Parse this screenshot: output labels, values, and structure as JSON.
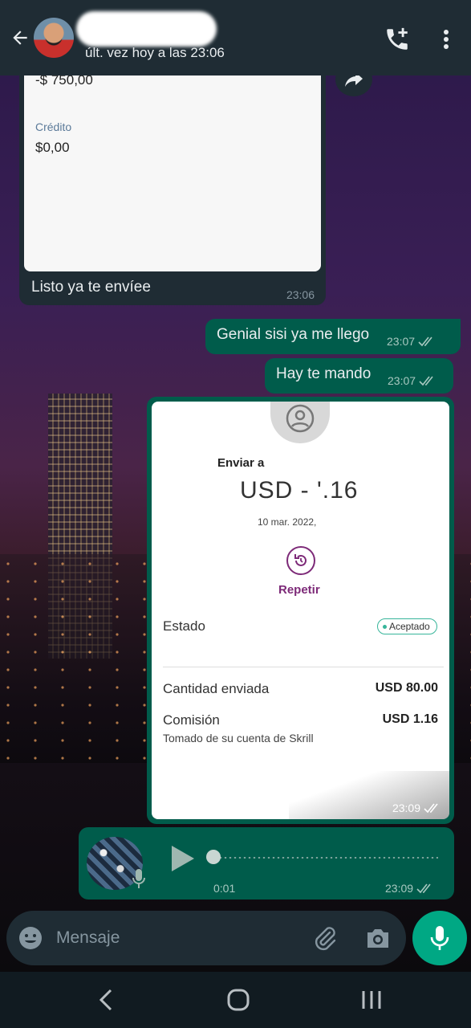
{
  "header": {
    "status": "últ. vez hoy a las 23:06"
  },
  "messages": {
    "incoming": {
      "card_amount": "-$ 750,00",
      "card_credit_label": "Crédito",
      "card_credit_value": "$0,00",
      "text": "Listo ya te envíee",
      "time": "23:06"
    },
    "out1": {
      "text": "Genial sisi ya me llego",
      "time": "23:07"
    },
    "out2": {
      "text": "Hay te mando",
      "time": "23:07"
    },
    "receipt": {
      "send_to": "Enviar a",
      "amount": "USD -    '.16",
      "date": "10 mar. 2022,",
      "repeat": "Repetir",
      "status_label": "Estado",
      "status_value": "Aceptado",
      "sent_label": "Cantidad enviada",
      "sent_value": "USD 80.00",
      "fee_label": "Comisión",
      "fee_value": "USD 1.16",
      "fee_note": "Tomado de su cuenta de Skrill",
      "time": "23:09"
    },
    "audio": {
      "duration": "0:01",
      "time": "23:09"
    }
  },
  "input": {
    "placeholder": "Mensaje"
  },
  "colors": {
    "header_bg": "#1f2c34",
    "outgoing_bubble": "#005c4b",
    "accent": "#00a884",
    "skrill_purple": "#7d2a78"
  },
  "icons": [
    "back-arrow-icon",
    "add-call-icon",
    "more-vert-icon",
    "forward-icon",
    "play-icon",
    "mic-icon",
    "emoji-icon",
    "attach-icon",
    "camera-icon",
    "nav-back-icon",
    "nav-home-icon",
    "nav-recents-icon"
  ]
}
